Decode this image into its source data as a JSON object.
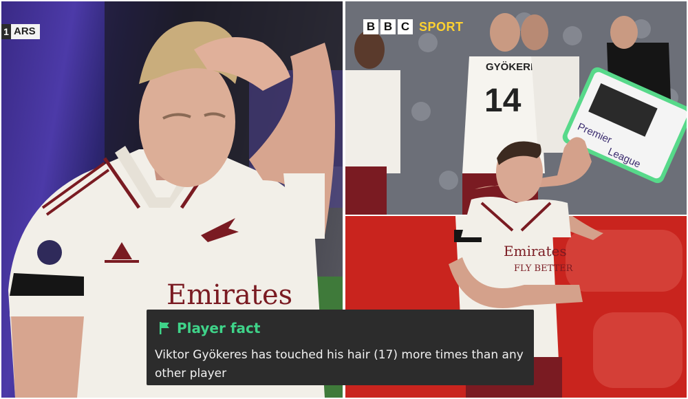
{
  "left_panel": {
    "score_bug": {
      "team": "ARS",
      "badge_digit": "1"
    }
  },
  "top_right_panel": {
    "broadcaster": {
      "letters": [
        "B",
        "B",
        "C"
      ],
      "sport_label": "SPORT"
    },
    "shirt_name": "GYÖKERES",
    "shirt_number": "14",
    "board_text": [
      "Premier",
      "League"
    ]
  },
  "bottom_right_panel": {
    "sponsor_text": [
      "Emirates",
      "FLY BETTER"
    ]
  },
  "fact_card": {
    "icon": "flag-icon",
    "title": "Player fact",
    "text": "Viktor Gyökeres has touched his hair (17) more times than any other player",
    "accent_color": "#3fd389",
    "background_color": "#2c2c2c"
  },
  "colors": {
    "kit_white": "#f2efe8",
    "kit_maroon": "#7a1b22",
    "pitch_green": "#3f7a3a",
    "board_green": "#57d98a"
  }
}
